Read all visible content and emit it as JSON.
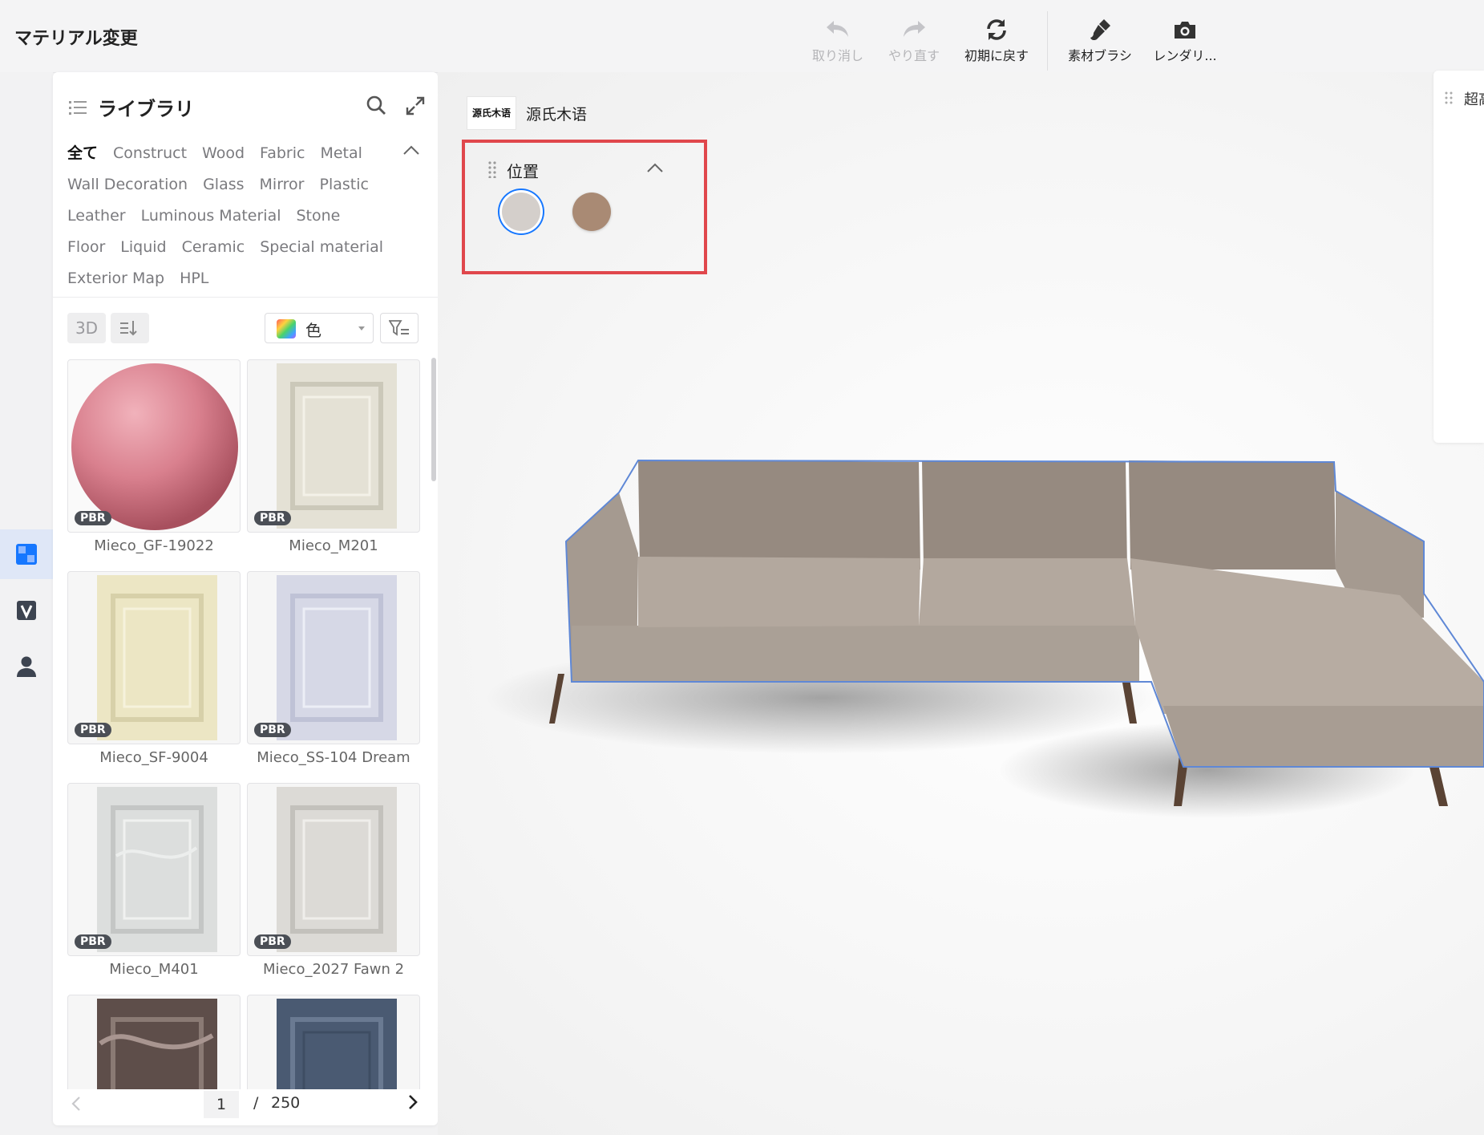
{
  "app": {
    "title": "マテリアル変更"
  },
  "toolbar": {
    "undo": "取り消し",
    "redo": "やり直す",
    "reset": "初期に戻す",
    "brush": "素材ブラシ",
    "render": "レンダリ..."
  },
  "library": {
    "title": "ライブラリ",
    "categories": [
      "全て",
      "Construct",
      "Wood",
      "Fabric",
      "Metal",
      "Wall Decoration",
      "Glass",
      "Mirror",
      "Plastic",
      "Leather",
      "Luminous Material",
      "Stone",
      "Floor",
      "Liquid",
      "Ceramic",
      "Special material",
      "Exterior Map",
      "HPL"
    ],
    "view_3d": "3D",
    "color_filter": "色",
    "materials": [
      {
        "name": "Mieco_GF-19022",
        "badge": "PBR"
      },
      {
        "name": "Mieco_M201",
        "badge": "PBR"
      },
      {
        "name": "Mieco_SF-9004",
        "badge": "PBR"
      },
      {
        "name": "Mieco_SS-104 Dream",
        "badge": "PBR"
      },
      {
        "name": "Mieco_M401",
        "badge": "PBR"
      },
      {
        "name": "Mieco_2027 Fawn 2",
        "badge": "PBR"
      },
      {
        "name": "",
        "badge": ""
      },
      {
        "name": "",
        "badge": ""
      }
    ],
    "pagination": {
      "current": "1",
      "separator": "/",
      "total": "250"
    }
  },
  "viewport": {
    "brand_logo_text": "源氏木语",
    "brand_name": "源氏木语",
    "position_panel": {
      "title": "位置",
      "swatches": [
        {
          "color": "#d4cfcb",
          "selected": true
        },
        {
          "color": "#a98a74",
          "selected": false
        }
      ]
    },
    "right_panel_label": "超高"
  },
  "colors": {
    "accent": "#1677ff",
    "highlight_border": "#e0474c",
    "sofa": "#b3a89e"
  }
}
